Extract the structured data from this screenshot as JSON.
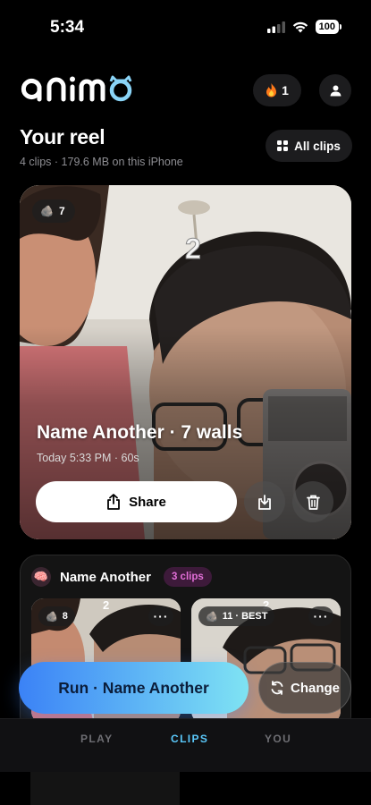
{
  "status_bar": {
    "time": "5:34",
    "battery": "100"
  },
  "header": {
    "logo_text": "animo",
    "streak_icon": "fire-icon",
    "streak_count": "1",
    "profile_icon": "person-icon"
  },
  "reel": {
    "title": "Your reel",
    "subtitle": "4 clips · 179.6 MB on this iPhone",
    "all_clips_label": "All clips"
  },
  "hero_clip": {
    "badge_icon": "rock-icon",
    "badge_count": "7",
    "title": "Name Another · 7 walls",
    "meta": "Today 5:33 PM · 60s",
    "share_label": "Share",
    "overlay_number": "2"
  },
  "group": {
    "icon": "brain-icon",
    "name": "Name Another",
    "clip_count": "3 clips",
    "thumbs": [
      {
        "badge_icon": "rock-icon",
        "badge": "8",
        "more": "···"
      },
      {
        "badge_icon": "rock-icon",
        "badge": "11 · BEST",
        "more": "···"
      }
    ]
  },
  "actions": {
    "run_label": "Run · Name Another",
    "change_label": "Change"
  },
  "tabs": [
    {
      "label": "PLAY",
      "active": false
    },
    {
      "label": "CLIPS",
      "active": true
    },
    {
      "label": "YOU",
      "active": false
    }
  ],
  "colors": {
    "accent": "#5ac8fa",
    "pill": "#e36fd8",
    "run_start": "#3b82f6",
    "run_end": "#7fe3f3"
  }
}
